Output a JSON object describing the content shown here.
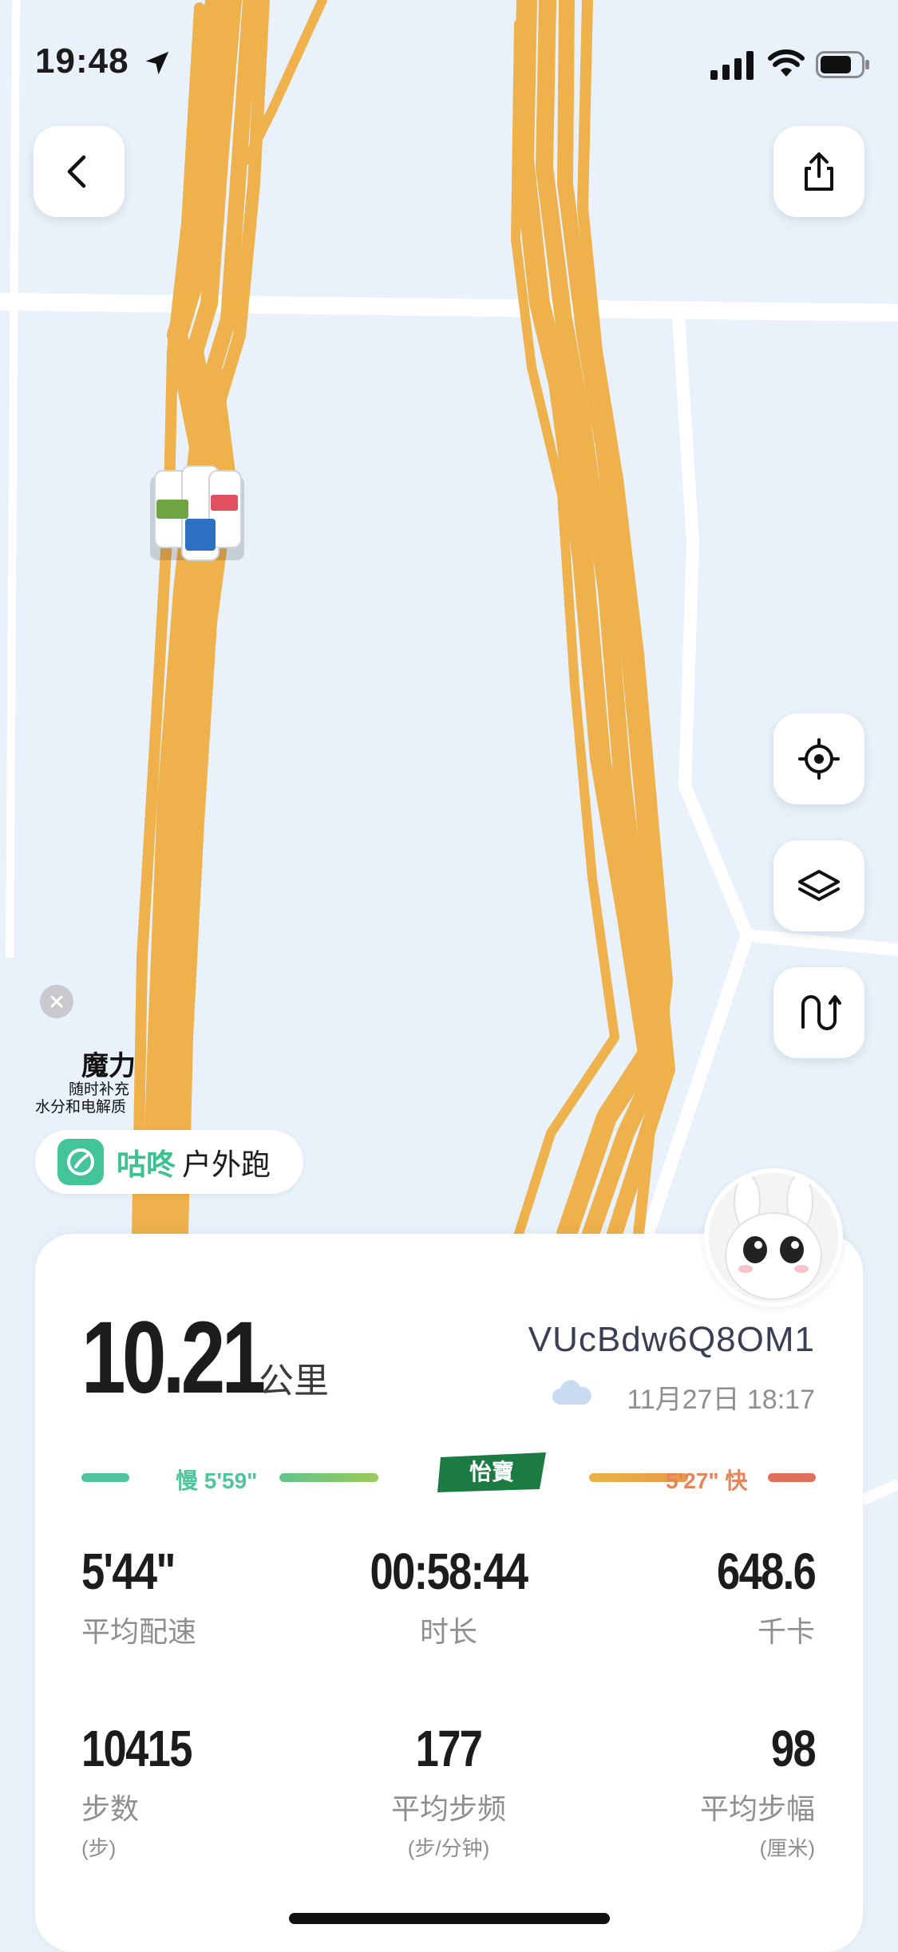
{
  "status_bar": {
    "time": "19:48"
  },
  "ad": {
    "brand": "魔力",
    "line1": "随时补充",
    "line2": "水分和电解质"
  },
  "app_badge": {
    "name": "咕咚",
    "activity": "户外跑"
  },
  "summary": {
    "distance": "10.21",
    "distance_unit": "公里",
    "run_id": "VUcBdw6Q8OM1",
    "date": "11月27日 18:17"
  },
  "pace_legend": {
    "slow": "慢 5'59\"",
    "fast": "5'27\" 快",
    "sponsor": "怡寶"
  },
  "metrics": {
    "avg_pace": {
      "value": "5'44\"",
      "label": "平均配速"
    },
    "duration": {
      "value": "00:58:44",
      "label": "时长"
    },
    "calories": {
      "value": "648.6",
      "label": "千卡"
    },
    "steps": {
      "value": "10415",
      "label": "步数",
      "unit": "(步)"
    },
    "cadence": {
      "value": "177",
      "label": "平均步频",
      "unit": "(步/分钟)"
    },
    "stride": {
      "value": "98",
      "label": "平均步幅",
      "unit": "(厘米)"
    }
  },
  "icons": {
    "back": "chevron-left-icon",
    "share": "share-icon",
    "locate": "locate-icon",
    "layers": "layers-icon",
    "route": "route-icon",
    "weather": "cloud-icon"
  },
  "colors": {
    "route": "#f0ad3c",
    "slow": "#52c49c",
    "fast": "#e6845a",
    "brand_green": "#3cc28e"
  }
}
